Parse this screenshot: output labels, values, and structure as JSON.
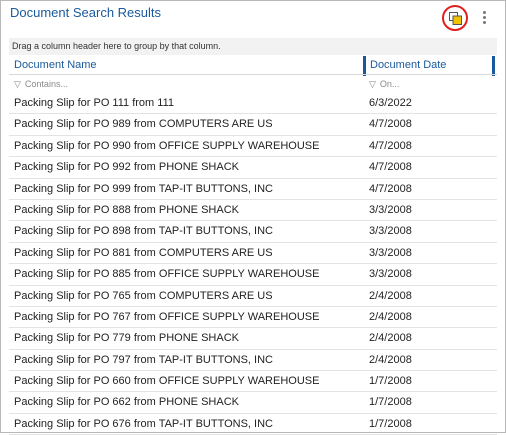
{
  "title": "Document Search Results",
  "icons": {
    "popout": "popout-window-icon",
    "menu": "more-vertical-icon",
    "filter": "funnel-icon"
  },
  "accent_color": "#1a5a9c",
  "highlight_color": "#e01f1f",
  "group_bar": "Drag a column header here to group by that column.",
  "columns": [
    {
      "label": "Document Name",
      "filter_placeholder": "Contains..."
    },
    {
      "label": "Document Date",
      "filter_placeholder": "On..."
    }
  ],
  "rows": [
    {
      "name": "Packing Slip for PO 111 from 111",
      "date": "6/3/2022"
    },
    {
      "name": "Packing Slip for PO 989 from COMPUTERS ARE US",
      "date": "4/7/2008"
    },
    {
      "name": "Packing Slip for PO 990 from OFFICE SUPPLY WAREHOUSE",
      "date": "4/7/2008"
    },
    {
      "name": "Packing Slip for PO 992 from PHONE SHACK",
      "date": "4/7/2008"
    },
    {
      "name": "Packing Slip for PO 999 from TAP-IT BUTTONS, INC",
      "date": "4/7/2008"
    },
    {
      "name": "Packing Slip for PO 888 from PHONE SHACK",
      "date": "3/3/2008"
    },
    {
      "name": "Packing Slip for PO 898 from TAP-IT BUTTONS, INC",
      "date": "3/3/2008"
    },
    {
      "name": "Packing Slip for PO 881 from COMPUTERS ARE US",
      "date": "3/3/2008"
    },
    {
      "name": "Packing Slip for PO 885 from OFFICE SUPPLY WAREHOUSE",
      "date": "3/3/2008"
    },
    {
      "name": "Packing Slip for PO 765 from COMPUTERS ARE US",
      "date": "2/4/2008"
    },
    {
      "name": "Packing Slip for PO 767 from OFFICE SUPPLY WAREHOUSE",
      "date": "2/4/2008"
    },
    {
      "name": "Packing Slip for PO 779 from PHONE SHACK",
      "date": "2/4/2008"
    },
    {
      "name": "Packing Slip for PO 797 from TAP-IT BUTTONS, INC",
      "date": "2/4/2008"
    },
    {
      "name": "Packing Slip for PO 660 from OFFICE SUPPLY WAREHOUSE",
      "date": "1/7/2008"
    },
    {
      "name": "Packing Slip for PO 662 from PHONE SHACK",
      "date": "1/7/2008"
    },
    {
      "name": "Packing Slip for PO 676 from TAP-IT BUTTONS, INC",
      "date": "1/7/2008"
    }
  ]
}
